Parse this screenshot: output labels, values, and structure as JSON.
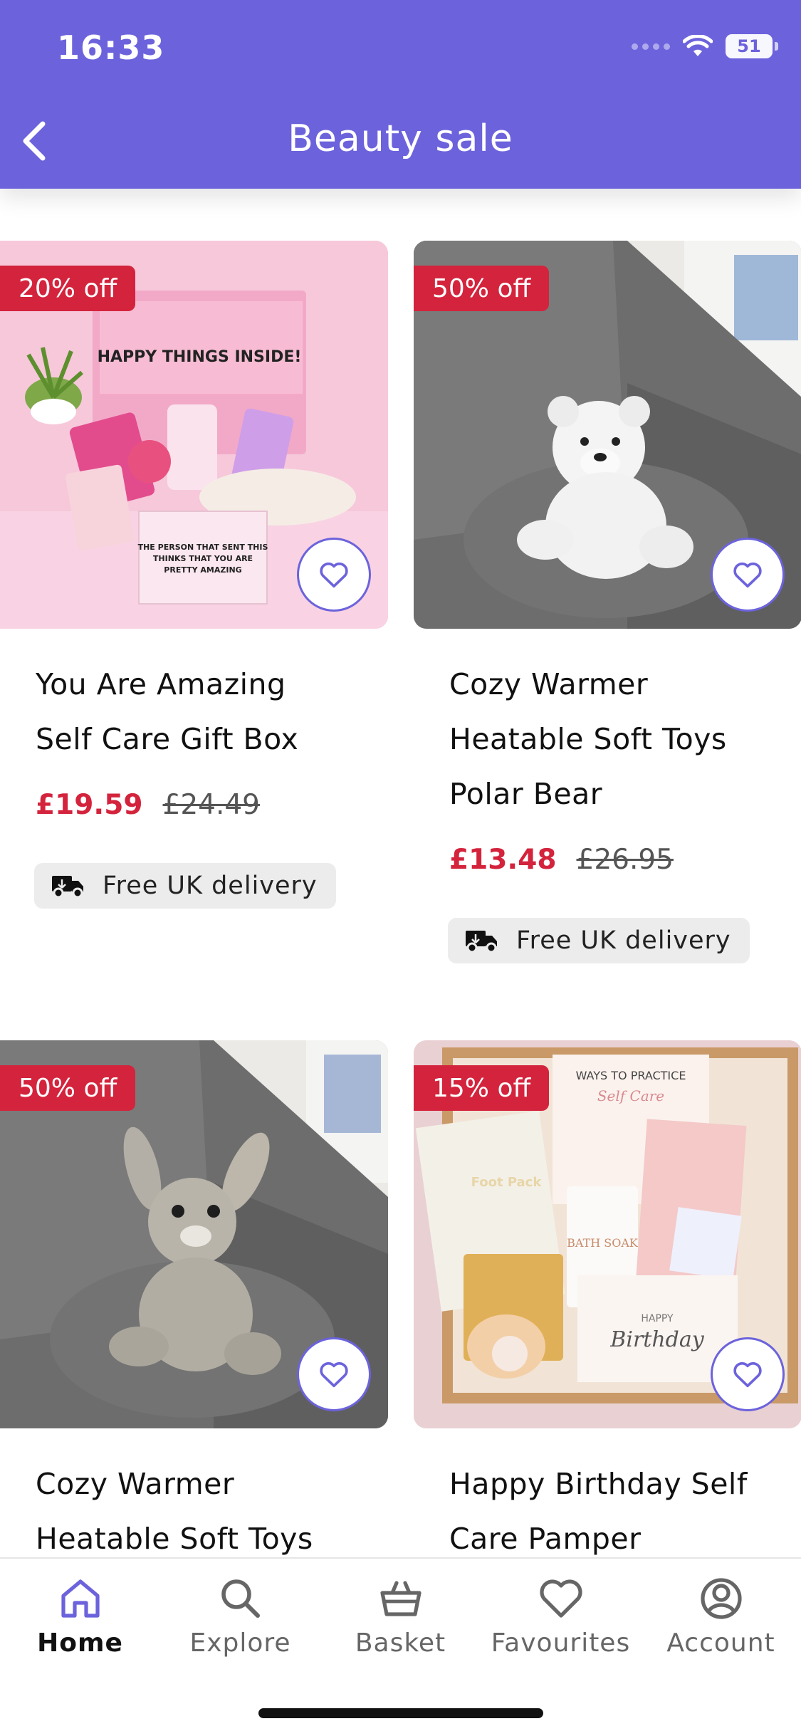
{
  "status_bar": {
    "time": "16:33",
    "battery": "51"
  },
  "header": {
    "title": "Beauty sale"
  },
  "products": [
    {
      "name_lines": [
        "You Are Amazing",
        "Self Care Gift Box"
      ],
      "badge": "20% off",
      "price": "£19.59",
      "was_price": "£24.49",
      "delivery": "Free UK delivery",
      "image": "pink-gift-box",
      "image_text": [
        "HAPPY THINGS INSIDE!",
        "THE PERSON THAT SENT THIS",
        "THINKS THAT YOU ARE",
        "PRETTY AMAZING"
      ]
    },
    {
      "name_lines": [
        "Cozy Warmer",
        "Heatable Soft Toys",
        "Polar Bear"
      ],
      "badge": "50% off",
      "price": "£13.48",
      "was_price": "£26.95",
      "delivery": "Free UK delivery",
      "image": "white-polar-bear-on-grey-sofa"
    },
    {
      "name_lines": [
        "Cozy Warmer",
        "Heatable Soft Toys"
      ],
      "badge": "50% off",
      "image": "grey-bunny-on-grey-sofa"
    },
    {
      "name_lines": [
        "Happy Birthday Self",
        "Care Pamper"
      ],
      "badge": "15% off",
      "image": "birthday-pamper-box",
      "image_text": [
        "WAYS TO PRACTICE",
        "Self Care",
        "Foot Pack",
        "BATH SOAK",
        "HAPPY",
        "Birthday"
      ]
    }
  ],
  "nav": [
    {
      "label": "Home",
      "icon": "home-icon",
      "active": true
    },
    {
      "label": "Explore",
      "icon": "search-icon",
      "active": false
    },
    {
      "label": "Basket",
      "icon": "basket-icon",
      "active": false
    },
    {
      "label": "Favourites",
      "icon": "heart-icon",
      "active": false
    },
    {
      "label": "Account",
      "icon": "account-icon",
      "active": false
    }
  ],
  "colors": {
    "brand": "#6c63dc",
    "sale_red": "#d4233c"
  }
}
